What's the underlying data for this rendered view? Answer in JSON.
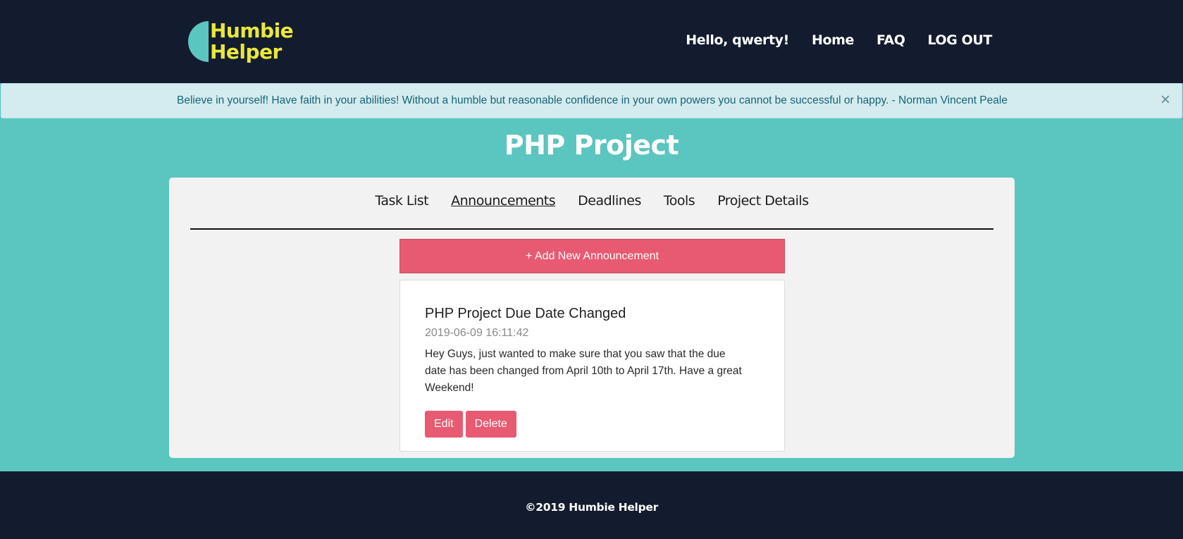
{
  "header": {
    "logo_line1": "Humbie",
    "logo_line2": "Helper",
    "nav": {
      "greeting": "Hello, qwerty!",
      "home": "Home",
      "faq": "FAQ",
      "logout": "LOG OUT"
    }
  },
  "alert": {
    "text": "Believe in yourself! Have faith in your abilities! Without a humble but reasonable confidence in your own powers you cannot be successful or happy. - Norman Vincent Peale",
    "close": "×"
  },
  "page": {
    "title": "PHP Project"
  },
  "tabs": {
    "task_list": "Task List",
    "announcements": "Announcements",
    "deadlines": "Deadlines",
    "tools": "Tools",
    "project_details": "Project Details",
    "active": "Announcements"
  },
  "add_button": "+ Add New Announcement",
  "announcement": {
    "title": "PHP Project Due Date Changed",
    "date": "2019-06-09 16:11:42",
    "body": "Hey Guys, just wanted to make sure that you saw that the due date has been changed from April 10th to April 17th. Have a great Weekend!",
    "edit": "Edit",
    "delete": "Delete"
  },
  "footer": {
    "text": "©2019 Humbie Helper"
  },
  "colors": {
    "navbar": "#131c2e",
    "page_bg": "#5bc5bf",
    "accent": "#e85a72",
    "logo_text": "#e9e83c",
    "alert_bg": "#d4ebef"
  }
}
